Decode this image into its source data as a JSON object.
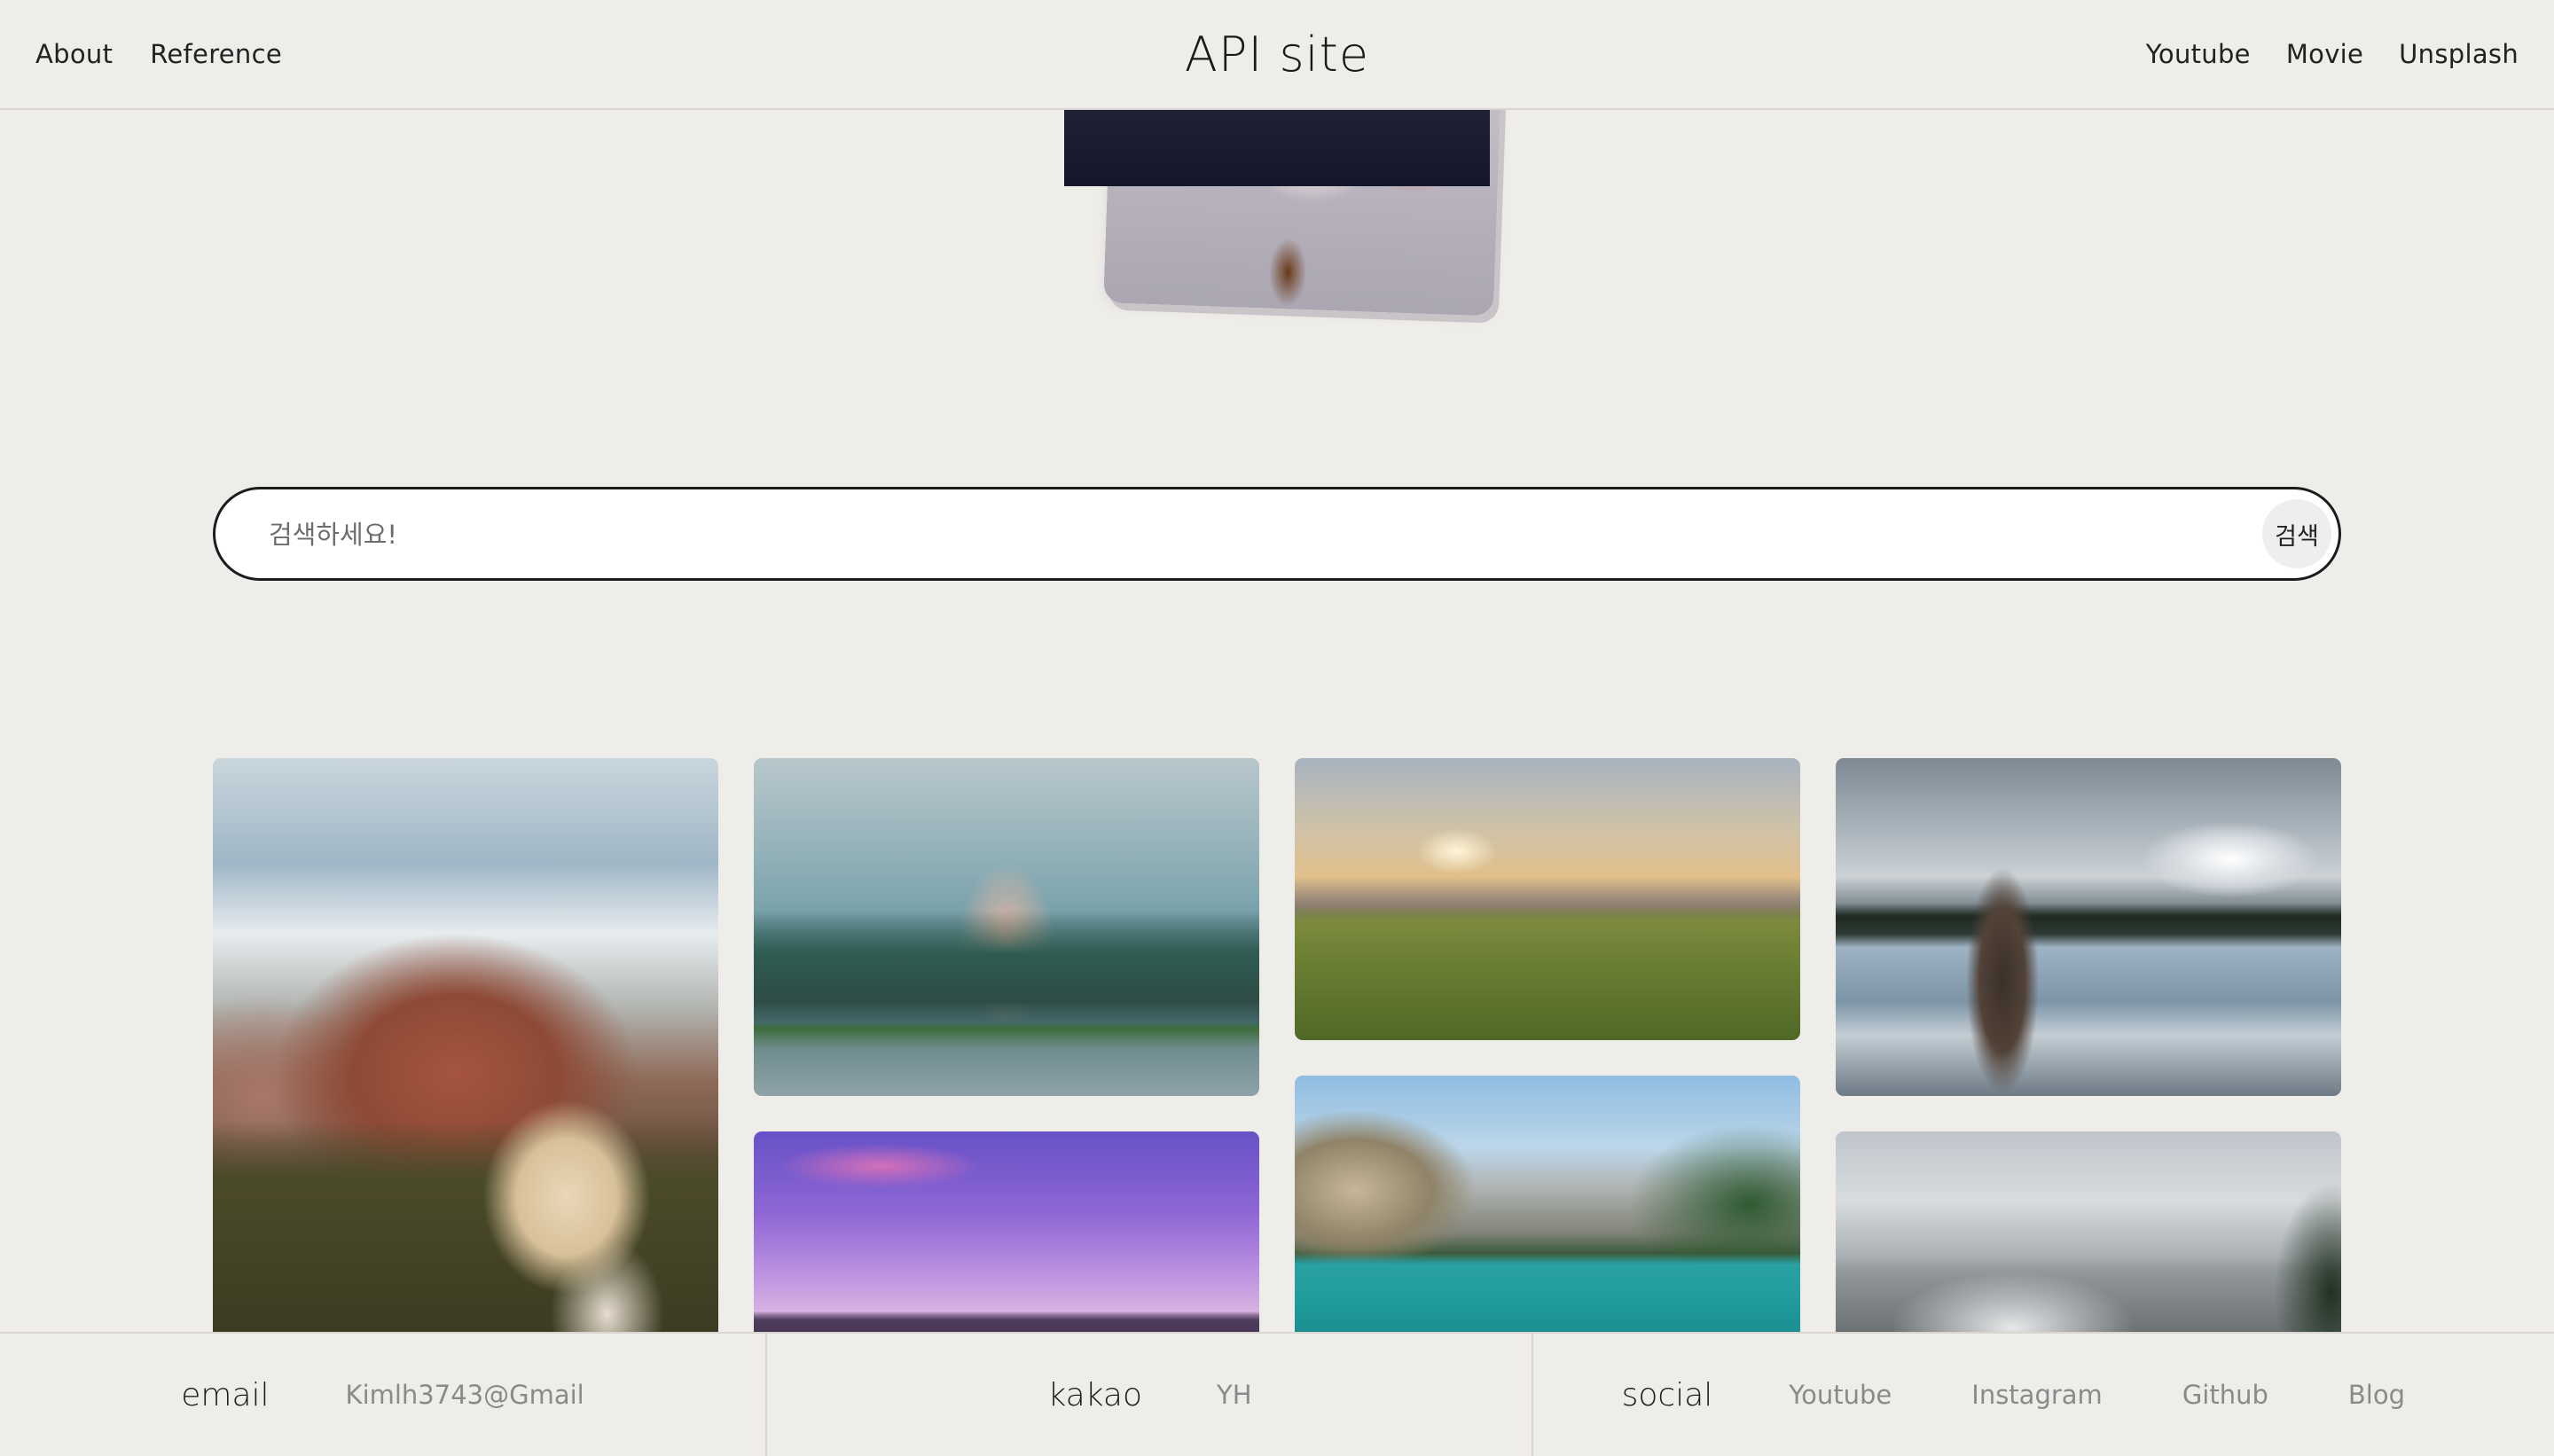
{
  "header": {
    "nav_left": [
      "About",
      "Reference"
    ],
    "title": "API site",
    "nav_right": [
      "Youtube",
      "Movie",
      "Unsplash"
    ]
  },
  "search": {
    "placeholder": "검색하세요!",
    "button_label": "검색"
  },
  "footer": {
    "email": {
      "heading": "email",
      "value": "Kimlh3743@Gmail"
    },
    "kakao": {
      "heading": "kakao",
      "value": "YH"
    },
    "social": {
      "heading": "social",
      "links": [
        "Youtube",
        "Instagram",
        "Github",
        "Blog"
      ]
    }
  }
}
